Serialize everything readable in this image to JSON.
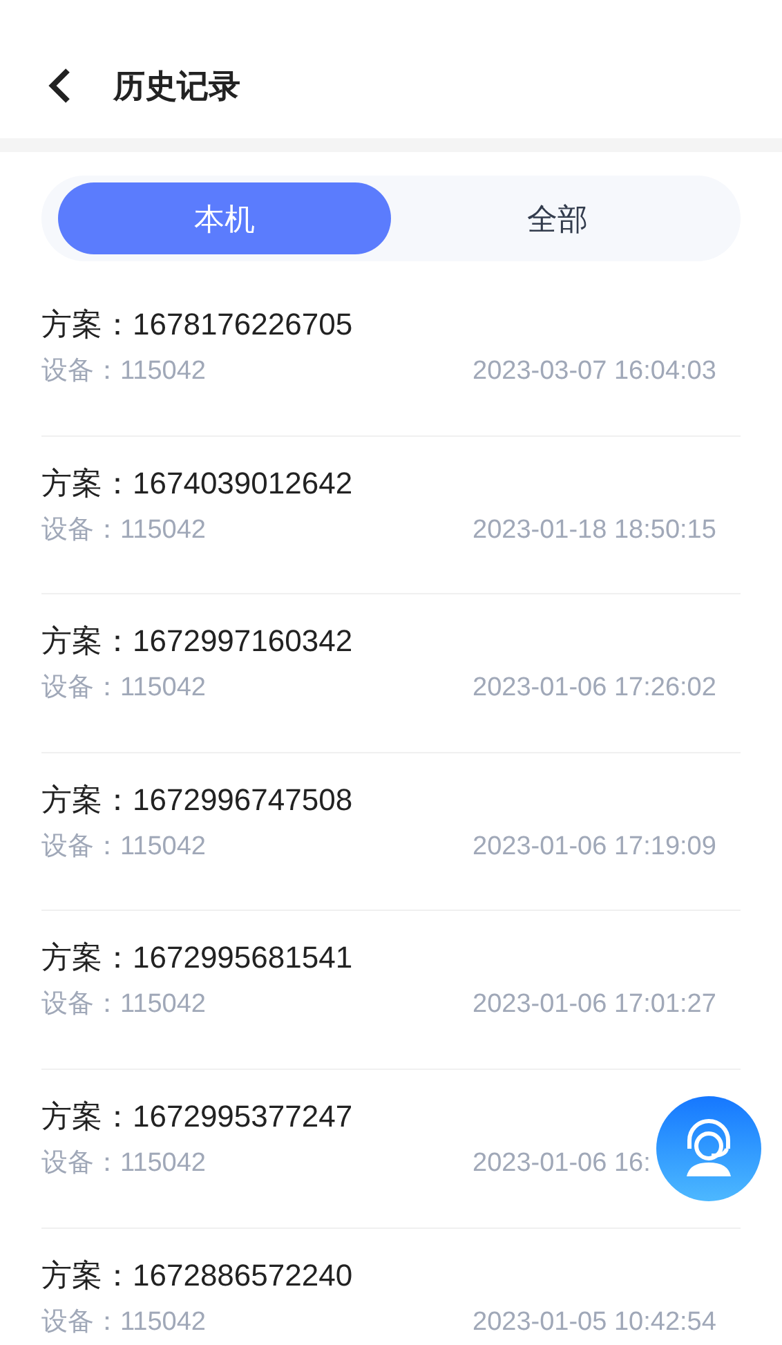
{
  "header": {
    "title": "历史记录"
  },
  "tabs": [
    {
      "label": "本机",
      "selected": true
    },
    {
      "label": "全部",
      "selected": false
    }
  ],
  "records": [
    {
      "plan": "方案：1678176226705",
      "device": "设备：115042",
      "time": "2023-03-07 16:04:03"
    },
    {
      "plan": "方案：1674039012642",
      "device": "设备：115042",
      "time": "2023-01-18 18:50:15"
    },
    {
      "plan": "方案：1672997160342",
      "device": "设备：115042",
      "time": "2023-01-06 17:26:02"
    },
    {
      "plan": "方案：1672996747508",
      "device": "设备：115042",
      "time": "2023-01-06 17:19:09"
    },
    {
      "plan": "方案：1672995681541",
      "device": "设备：115042",
      "time": "2023-01-06 17:01:27"
    },
    {
      "plan": "方案：1672995377247",
      "device": "设备：115042",
      "time": "2023-01-06 16:"
    },
    {
      "plan": "方案：1672886572240",
      "device": "设备：115042",
      "time": "2023-01-05 10:42:54"
    }
  ]
}
